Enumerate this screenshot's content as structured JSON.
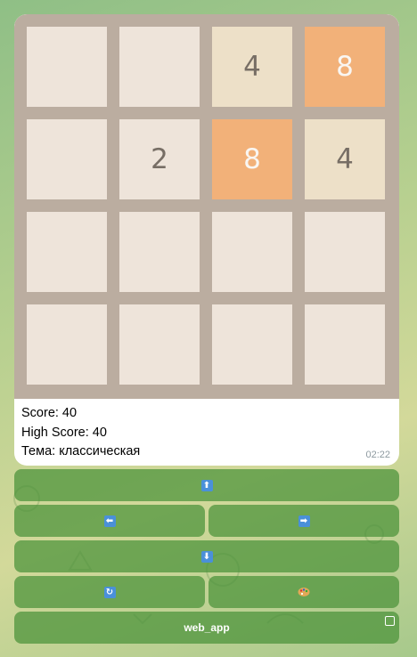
{
  "board": {
    "cells": [
      [
        "",
        "",
        "4",
        "8"
      ],
      [
        "",
        "2",
        "8",
        "4"
      ],
      [
        "",
        "",
        "",
        ""
      ],
      [
        "",
        "",
        "",
        ""
      ]
    ]
  },
  "caption": {
    "score": "Score: 40",
    "high_score": "High Score: 40",
    "theme": "Тема: классическая",
    "time": "02:22"
  },
  "keyboard": {
    "up_icon": "up-arrow-icon",
    "left_icon": "left-arrow-icon",
    "right_icon": "right-arrow-icon",
    "down_icon": "down-arrow-icon",
    "restart_icon": "restart-icon",
    "theme_icon": "palette-icon",
    "web_app_label": "web_app"
  },
  "colors": {
    "board": "#bbada0",
    "empty_tile": "#eee4da",
    "tile_2": "#eee4da",
    "tile_4": "#ede0c8",
    "tile_8": "#f2b179",
    "button": "#5a9a48"
  }
}
